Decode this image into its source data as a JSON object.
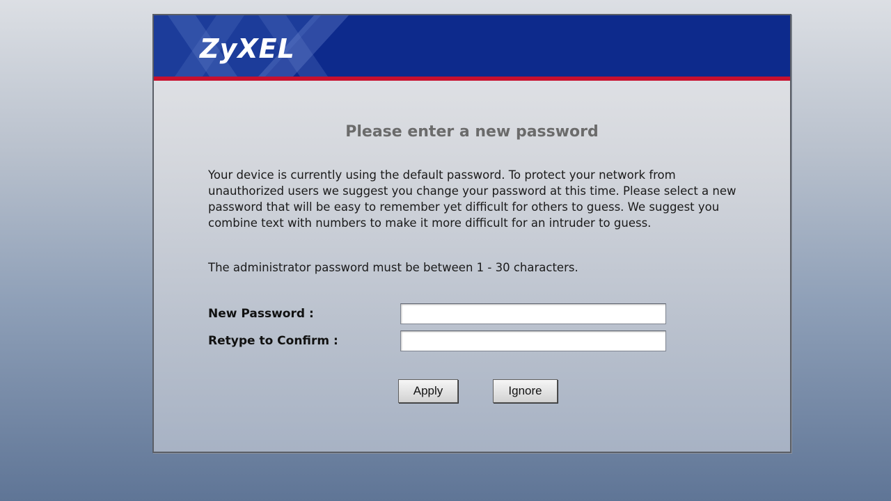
{
  "header": {
    "logo_text": "ZyXEL",
    "brand_color": "#0d2a8c",
    "accent_color": "#c8102e"
  },
  "main": {
    "title": "Please enter a new password",
    "intro": "Your device is currently using the default password. To protect your network from unauthorized users we suggest you change your password at this time. Please select a new password that will be easy to remember yet difficult for others to guess. We suggest you combine text with numbers to make it more difficult for an intruder to guess.",
    "rule": "The administrator password must be between 1 - 30 characters."
  },
  "form": {
    "new_password_label": "New Password :",
    "new_password_value": "",
    "confirm_label": "Retype to Confirm :",
    "confirm_value": ""
  },
  "actions": {
    "apply_label": "Apply",
    "ignore_label": "Ignore"
  }
}
